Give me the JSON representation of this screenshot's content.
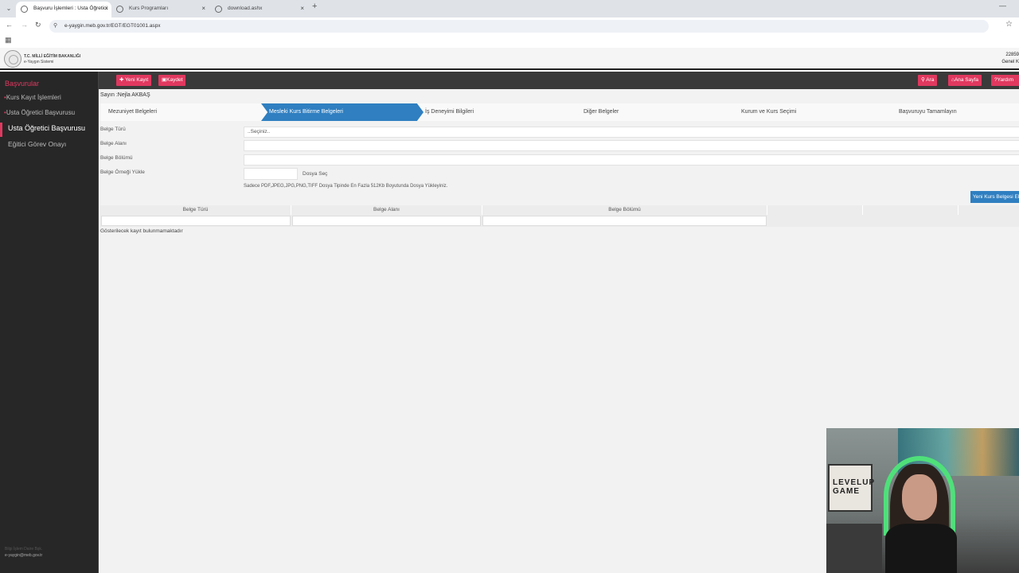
{
  "browser": {
    "tabs": [
      {
        "label": "Başvuru İşlemleri : Usta Öğretici",
        "active": true
      },
      {
        "label": "Kurs Programları",
        "active": false
      },
      {
        "label": "download.ashx",
        "active": false
      }
    ],
    "url": "e-yaygin.meb.gov.tr/EGT/EGT01001.aspx",
    "new_tab_glyph": "+",
    "close_glyph": "×"
  },
  "header": {
    "logo_line1": "T.C. MİLLİ EĞİTİM BAKANLIĞI",
    "logo_line2": "e-Yaygın Sistemi",
    "right_line1": "22859",
    "right_line2": "Genel K"
  },
  "sidebar": {
    "title": "Başvurular",
    "items": [
      {
        "label": "Kurs Kayıt İşlemleri",
        "marker": "•"
      },
      {
        "label": "Usta Öğretici Başvurusu",
        "marker": "•"
      },
      {
        "label": "Usta Öğretici Başvurusu",
        "marker": ""
      },
      {
        "label": "Eğitici Görev Onayı",
        "marker": ""
      }
    ],
    "footer_line1": "Bilgi İşlem Daire Bşk.",
    "footer_line2": "e-yaygin@meb.gov.tr"
  },
  "toolbar": {
    "new_record": "Yeni Kayıt",
    "save": "Kaydet",
    "search": "Ara",
    "home": "Ana Sayfa",
    "help": "Yardım"
  },
  "greeting": "Sayın :Nejla AKBAŞ",
  "steps": [
    {
      "label": "Mezuniyet Belgeleri",
      "active": false
    },
    {
      "label": "Mesleki Kurs Bitirme Belgeleri",
      "active": true
    },
    {
      "label": "İş Deneyimi Bilgileri",
      "active": false
    },
    {
      "label": "Diğer Belgeler",
      "active": false
    },
    {
      "label": "Kurum ve Kurs Seçimi",
      "active": false
    },
    {
      "label": "Başvuruyu Tamamlayın",
      "active": false
    }
  ],
  "form": {
    "doc_type_label": "Belge Türü",
    "doc_type_value": "..Seçiniz..",
    "doc_area_label": "Belge Alanı",
    "doc_section_label": "Belge Bölümü",
    "doc_upload_label": "Belge Örneği Yükle",
    "file_button": "Dosya Seç",
    "file_note": "Sadece PDF,JPEG,JPG,PNG,TIFF Dosya Tipinde En Fazla 512Kb Boyutunda Dosya Yükleyiniz.",
    "add_button": "Yeni Kurs Belgesi Ekle"
  },
  "table": {
    "headers": [
      "Belge Türü",
      "Belge Alanı",
      "Belge Bölümü",
      "",
      "",
      ""
    ],
    "empty_message": "Gösterilecek kayıt bulunmamaktadır"
  },
  "webcam": {
    "board_text": "LEVELUP GAME"
  },
  "colors": {
    "accent_red": "#e0385f",
    "accent_blue": "#2f7fc1",
    "sidebar_bg": "#272727",
    "toolbar_bg": "#3a3a3a"
  }
}
